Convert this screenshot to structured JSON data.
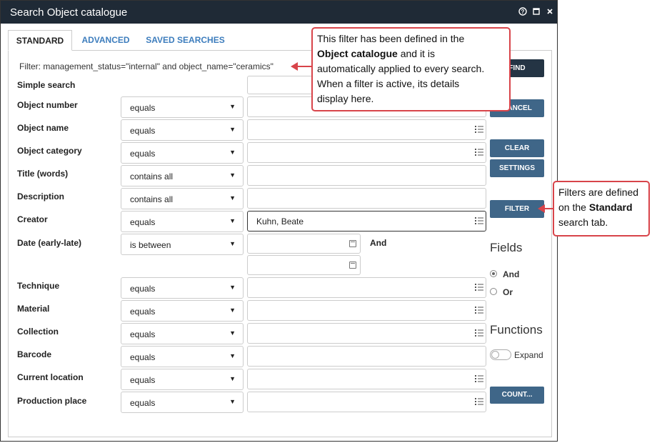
{
  "window": {
    "title": "Search Object catalogue",
    "help_icon": "help-icon",
    "maximize_icon": "maximize-icon",
    "close_icon": "close-icon"
  },
  "tabs": [
    {
      "label": "STANDARD",
      "active": true
    },
    {
      "label": "ADVANCED",
      "active": false
    },
    {
      "label": "SAVED SEARCHES",
      "active": false
    }
  ],
  "filter_text": "Filter: management_status=\"internal\" and object_name=\"ceramics\"",
  "fields": [
    {
      "label": "Simple search",
      "operator": "",
      "value": ""
    },
    {
      "label": "Object number",
      "operator": "equals",
      "value": ""
    },
    {
      "label": "Object name",
      "operator": "equals",
      "value": ""
    },
    {
      "label": "Object category",
      "operator": "equals",
      "value": ""
    },
    {
      "label": "Title (words)",
      "operator": "contains all",
      "value": ""
    },
    {
      "label": "Description",
      "operator": "contains all",
      "value": ""
    },
    {
      "label": "Creator",
      "operator": "equals",
      "value": "Kuhn, Beate"
    },
    {
      "label": "Date (early-late)",
      "operator": "is between",
      "value": ""
    },
    {
      "label": "Technique",
      "operator": "equals",
      "value": ""
    },
    {
      "label": "Material",
      "operator": "equals",
      "value": ""
    },
    {
      "label": "Collection",
      "operator": "equals",
      "value": ""
    },
    {
      "label": "Barcode",
      "operator": "equals",
      "value": ""
    },
    {
      "label": "Current location",
      "operator": "equals",
      "value": ""
    },
    {
      "label": "Production place",
      "operator": "equals",
      "value": ""
    }
  ],
  "date_and_label": "And",
  "buttons": {
    "find": "FIND",
    "cancel": "CANCEL",
    "clear": "CLEAR",
    "settings": "SETTINGS",
    "filter": "FILTER",
    "count": "COUNT..."
  },
  "fields_section": {
    "title": "Fields",
    "options": [
      {
        "label": "And",
        "selected": true
      },
      {
        "label": "Or",
        "selected": false
      }
    ]
  },
  "functions_section": {
    "title": "Functions",
    "expand_label": "Expand",
    "expand_on": false
  },
  "callouts": {
    "filter_note": {
      "line1": "This filter has been defined in the",
      "bold1": "Object catalogue",
      "line2_rest": " and it is",
      "line3": "automatically applied to every search.",
      "line4": "When a filter is active, its details",
      "line5": "display here."
    },
    "standard_note": {
      "line1": "Filters are defined",
      "line2_pre": "on the ",
      "bold": "Standard",
      "line3": "search tab."
    }
  },
  "colors": {
    "titlebar": "#1f2a36",
    "button": "#3f6688",
    "tab_link": "#3d7dbd",
    "callout_border": "#d8444a"
  }
}
